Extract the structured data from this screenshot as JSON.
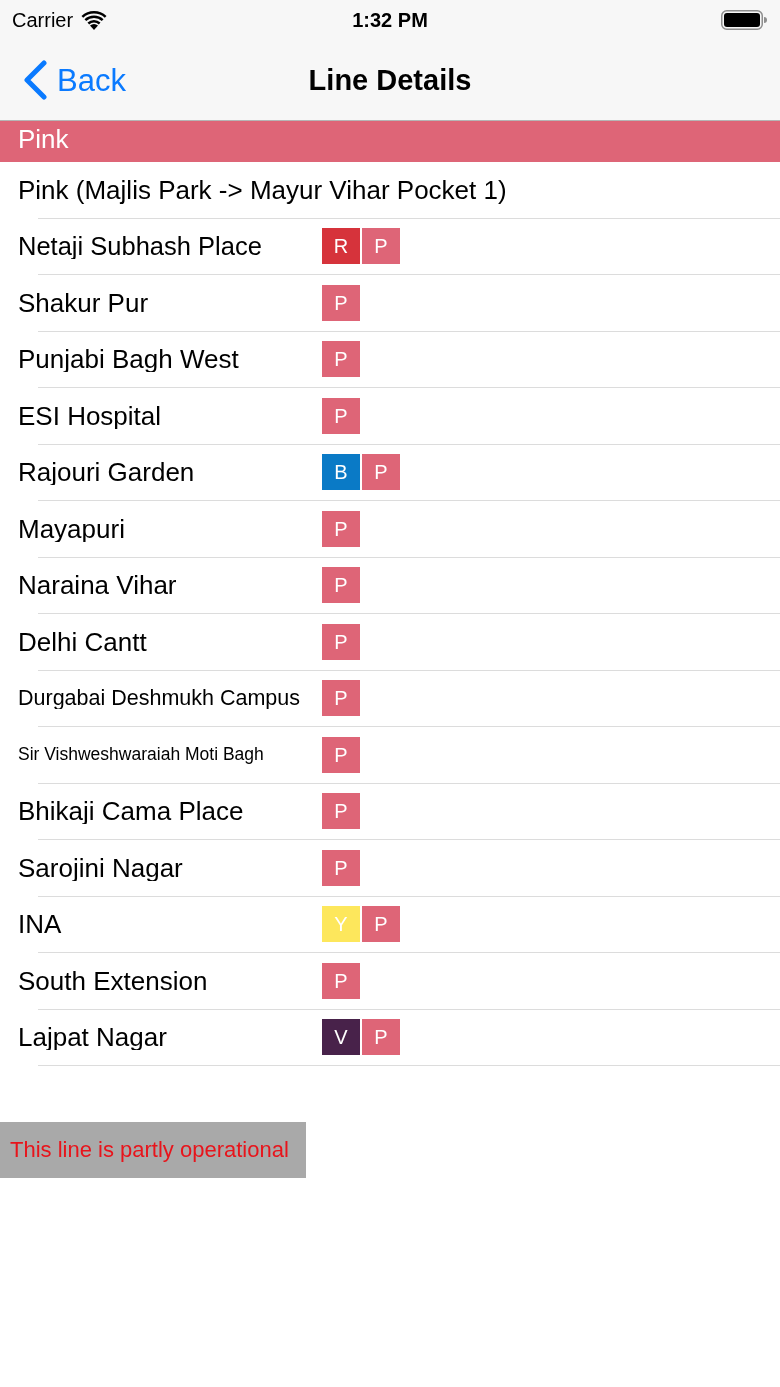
{
  "status_bar": {
    "carrier": "Carrier",
    "time": "1:32 PM"
  },
  "nav_bar": {
    "back": "Back",
    "title": "Line Details"
  },
  "section": {
    "title": "Pink"
  },
  "rows": [
    {
      "kind": "title",
      "label": "Pink (Majlis Park -> Mayur Vihar Pocket 1)"
    },
    {
      "kind": "station",
      "label": "Netaji Subhash Place",
      "lines": [
        {
          "letter": "R",
          "color": "#d6333b"
        },
        {
          "letter": "P",
          "color": "#de6577"
        }
      ]
    },
    {
      "kind": "station",
      "label": "Shakur Pur",
      "lines": [
        {
          "letter": "P",
          "color": "#de6577"
        }
      ]
    },
    {
      "kind": "station",
      "label": "Punjabi Bagh West",
      "lines": [
        {
          "letter": "P",
          "color": "#de6577"
        }
      ]
    },
    {
      "kind": "station",
      "label": "ESI Hospital",
      "lines": [
        {
          "letter": "P",
          "color": "#de6577"
        }
      ]
    },
    {
      "kind": "station",
      "label": "Rajouri Garden",
      "lines": [
        {
          "letter": "B",
          "color": "#0a7ac6"
        },
        {
          "letter": "P",
          "color": "#de6577"
        }
      ]
    },
    {
      "kind": "station",
      "label": "Mayapuri",
      "lines": [
        {
          "letter": "P",
          "color": "#de6577"
        }
      ]
    },
    {
      "kind": "station",
      "label": "Naraina Vihar",
      "lines": [
        {
          "letter": "P",
          "color": "#de6577"
        }
      ]
    },
    {
      "kind": "station",
      "label": "Delhi Cantt",
      "lines": [
        {
          "letter": "P",
          "color": "#de6577"
        }
      ]
    },
    {
      "kind": "station",
      "label": "Durgabai Deshmukh Campus",
      "lines": [
        {
          "letter": "P",
          "color": "#de6577"
        }
      ]
    },
    {
      "kind": "station",
      "label": "Sir Vishweshwaraiah Moti Bagh",
      "lines": [
        {
          "letter": "P",
          "color": "#de6577"
        }
      ]
    },
    {
      "kind": "station",
      "label": "Bhikaji Cama Place",
      "lines": [
        {
          "letter": "P",
          "color": "#de6577"
        }
      ]
    },
    {
      "kind": "station",
      "label": "Sarojini Nagar",
      "lines": [
        {
          "letter": "P",
          "color": "#de6577"
        }
      ]
    },
    {
      "kind": "station",
      "label": "INA",
      "lines": [
        {
          "letter": "Y",
          "color": "#fde75c"
        },
        {
          "letter": "P",
          "color": "#de6577"
        }
      ]
    },
    {
      "kind": "station",
      "label": "South Extension",
      "lines": [
        {
          "letter": "P",
          "color": "#de6577"
        }
      ]
    },
    {
      "kind": "station",
      "label": "Lajpat Nagar",
      "lines": [
        {
          "letter": "V",
          "color": "#48224a"
        },
        {
          "letter": "P",
          "color": "#de6577"
        }
      ]
    }
  ],
  "notice": "This line is partly operational"
}
